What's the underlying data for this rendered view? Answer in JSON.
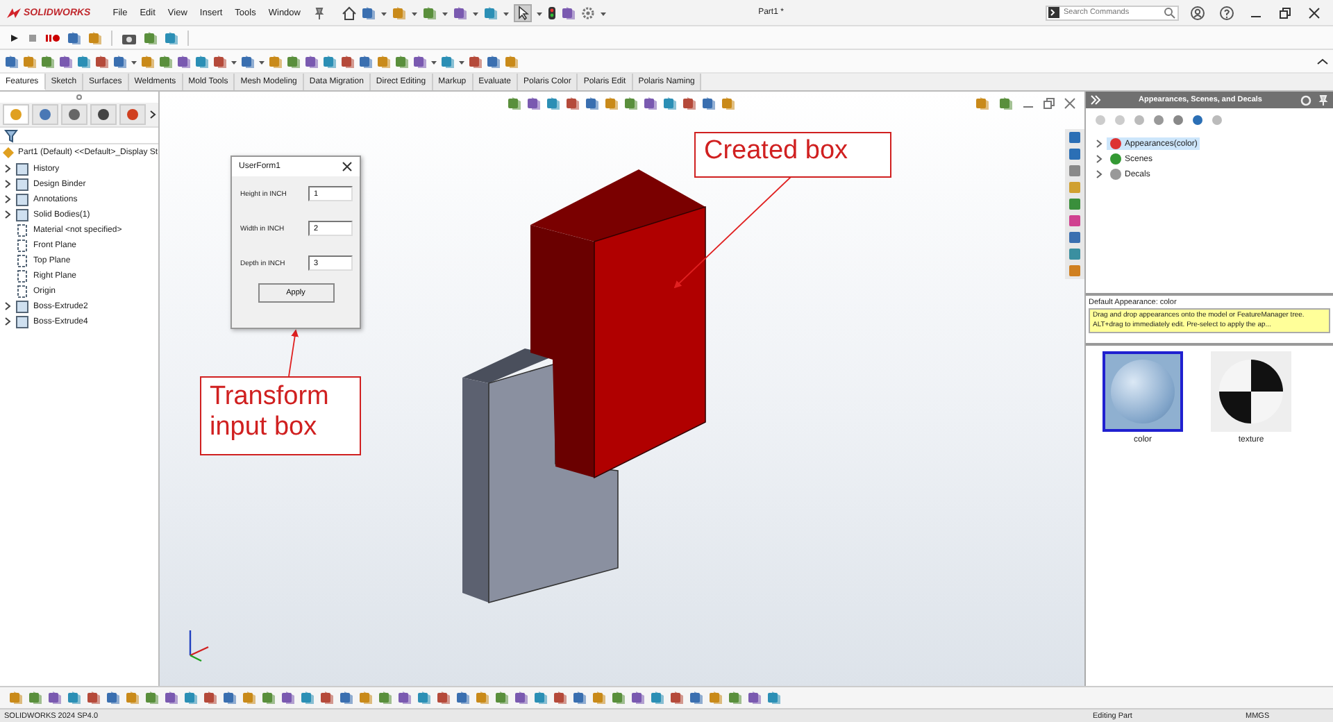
{
  "app": {
    "logo": "SOLIDWORKS",
    "menu": [
      "File",
      "Edit",
      "View",
      "Insert",
      "Tools",
      "Window"
    ],
    "document_title": "Part1 *",
    "search": {
      "placeholder": "Search Commands"
    }
  },
  "command_tabs": [
    {
      "label": "Features",
      "selected": true
    },
    {
      "label": "Sketch",
      "selected": false
    },
    {
      "label": "Surfaces",
      "selected": false
    },
    {
      "label": "Weldments",
      "selected": false
    },
    {
      "label": "Mold Tools",
      "selected": false
    },
    {
      "label": "Mesh Modeling",
      "selected": false
    },
    {
      "label": "Data Migration",
      "selected": false
    },
    {
      "label": "Direct Editing",
      "selected": false
    },
    {
      "label": "Markup",
      "selected": false
    },
    {
      "label": "Evaluate",
      "selected": false
    },
    {
      "label": "Polaris Color",
      "selected": false
    },
    {
      "label": "Polaris Edit",
      "selected": false
    },
    {
      "label": "Polaris Naming",
      "selected": false
    }
  ],
  "manager_tabs": [
    {
      "selected": true
    },
    {
      "selected": false
    },
    {
      "selected": false
    },
    {
      "selected": false
    },
    {
      "selected": false
    }
  ],
  "feature_tree": {
    "root": "Part1 (Default) <<Default>_Display St",
    "items": [
      {
        "label": "History",
        "expandable": true
      },
      {
        "label": "Design Binder",
        "expandable": true
      },
      {
        "label": "Annotations",
        "expandable": true
      },
      {
        "label": "Solid Bodies(1)",
        "expandable": true
      },
      {
        "label": "Material <not specified>",
        "expandable": false
      },
      {
        "label": "Front Plane",
        "expandable": false
      },
      {
        "label": "Top Plane",
        "expandable": false
      },
      {
        "label": "Right Plane",
        "expandable": false
      },
      {
        "label": "Origin",
        "expandable": false
      },
      {
        "label": "Boss-Extrude2",
        "expandable": true
      },
      {
        "label": "Boss-Extrude4",
        "expandable": true
      }
    ]
  },
  "user_form": {
    "title": "UserForm1",
    "fields": [
      {
        "label": "Height in INCH",
        "value": "1"
      },
      {
        "label": "Width in INCH",
        "value": "2"
      },
      {
        "label": "Depth in INCH",
        "value": "3"
      }
    ],
    "button": "Apply"
  },
  "callouts": [
    {
      "text": "Created box"
    },
    {
      "text": "Transform input box"
    }
  ],
  "task_pane": {
    "title": "Appearances, Scenes, and Decals",
    "tree": [
      {
        "label": "Appearances(color)",
        "selected": true
      },
      {
        "label": "Scenes",
        "selected": false
      },
      {
        "label": "Decals",
        "selected": false
      }
    ],
    "description": "Default Appearance: color",
    "tooltip": "Drag and drop appearances onto the model or FeatureManager tree.  ALT+drag to immediately edit.  Pre-select to apply the ap...",
    "thumbnails": [
      {
        "label": "color",
        "selected": true
      },
      {
        "label": "texture",
        "selected": false
      }
    ]
  },
  "status_bar": {
    "version": "SOLIDWORKS 2024 SP4.0",
    "mode": "Editing Part",
    "units": "MMGS"
  }
}
